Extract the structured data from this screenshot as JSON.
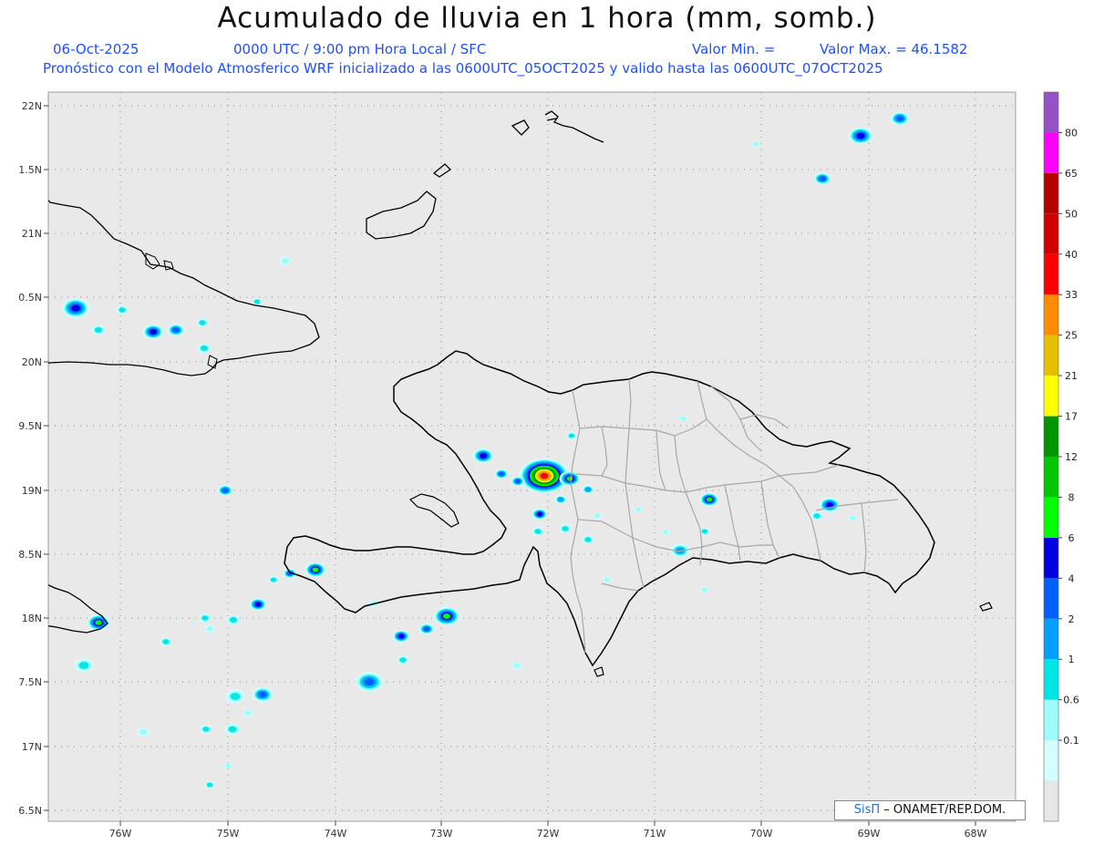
{
  "header": {
    "title": "Acumulado de lluvia en 1 hora (mm, somb.)",
    "date": "06-Oct-2025",
    "time": "0000 UTC / 9:00 pm Hora Local / SFC",
    "vmin": "Valor Min. =",
    "vmax": "Valor Max. = 46.1582",
    "model": "Pronóstico con el Modelo Atmosferico WRF inicializado a las 0600UTC_05OCT2025 y valido hasta las  0600UTC_07OCT2025"
  },
  "axes": {
    "lon_labels": [
      "76W",
      "75W",
      "74W",
      "73W",
      "72W",
      "71W",
      "70W",
      "69W",
      "68W"
    ],
    "lat_labels": [
      "22N",
      "1.5N",
      "21N",
      "0.5N",
      "20N",
      "9.5N",
      "19N",
      "8.5N",
      "18N",
      "7.5N",
      "17N",
      "6.5N"
    ]
  },
  "legend": {
    "labels": [
      "0.1",
      "0.6",
      "1",
      "2",
      "4",
      "6",
      "8",
      "12",
      "17",
      "21",
      "25",
      "33",
      "40",
      "50",
      "65",
      "80"
    ],
    "colors": [
      "#e6e6e6",
      "#d3fefe",
      "#9cfcfc",
      "#00e6e6",
      "#00a0ff",
      "#0060ff",
      "#0000e0",
      "#00ff00",
      "#00c800",
      "#009600",
      "#ffff00",
      "#e6be00",
      "#ff8c00",
      "#ff0000",
      "#d20000",
      "#b40000",
      "#ff00ff",
      "#9650c8"
    ]
  },
  "credit": {
    "brand": "SisΠ",
    "text": "– ONAMET/REP.DOM."
  },
  "colors": {
    "ocean": "#e9e9e9",
    "coast": "#000000",
    "border": "#a8a8a8",
    "grid": "#888888"
  }
}
